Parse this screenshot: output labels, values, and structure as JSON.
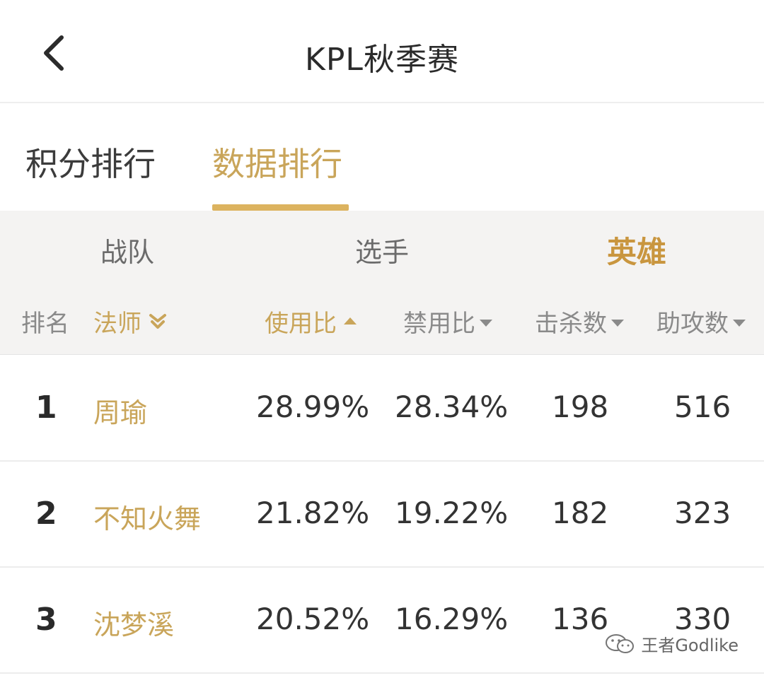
{
  "header": {
    "title": "KPL秋季赛"
  },
  "tabs": [
    {
      "label": "积分排行",
      "active": false
    },
    {
      "label": "数据排行",
      "active": true
    }
  ],
  "subtabs": [
    {
      "label": "战队",
      "active": false
    },
    {
      "label": "选手",
      "active": false
    },
    {
      "label": "英雄",
      "active": true
    }
  ],
  "columns": {
    "rank": "排名",
    "hero_class": "法师",
    "use_rate": "使用比",
    "ban_rate": "禁用比",
    "kills": "击杀数",
    "assists": "助攻数"
  },
  "rows": [
    {
      "rank": "1",
      "hero": "周瑜",
      "use_rate": "28.99%",
      "ban_rate": "28.34%",
      "kills": "198",
      "assists": "516"
    },
    {
      "rank": "2",
      "hero": "不知火舞",
      "use_rate": "21.82%",
      "ban_rate": "19.22%",
      "kills": "182",
      "assists": "323"
    },
    {
      "rank": "3",
      "hero": "沈梦溪",
      "use_rate": "20.52%",
      "ban_rate": "16.29%",
      "kills": "136",
      "assists": "330"
    }
  ],
  "watermark": {
    "text": "王者Godlike",
    "icon": "wechat-icon"
  },
  "colors": {
    "accent": "#c9a55a",
    "accent_bold": "#c9963f",
    "underline": "#dcb35f",
    "header_bg": "#f4f3f2"
  }
}
